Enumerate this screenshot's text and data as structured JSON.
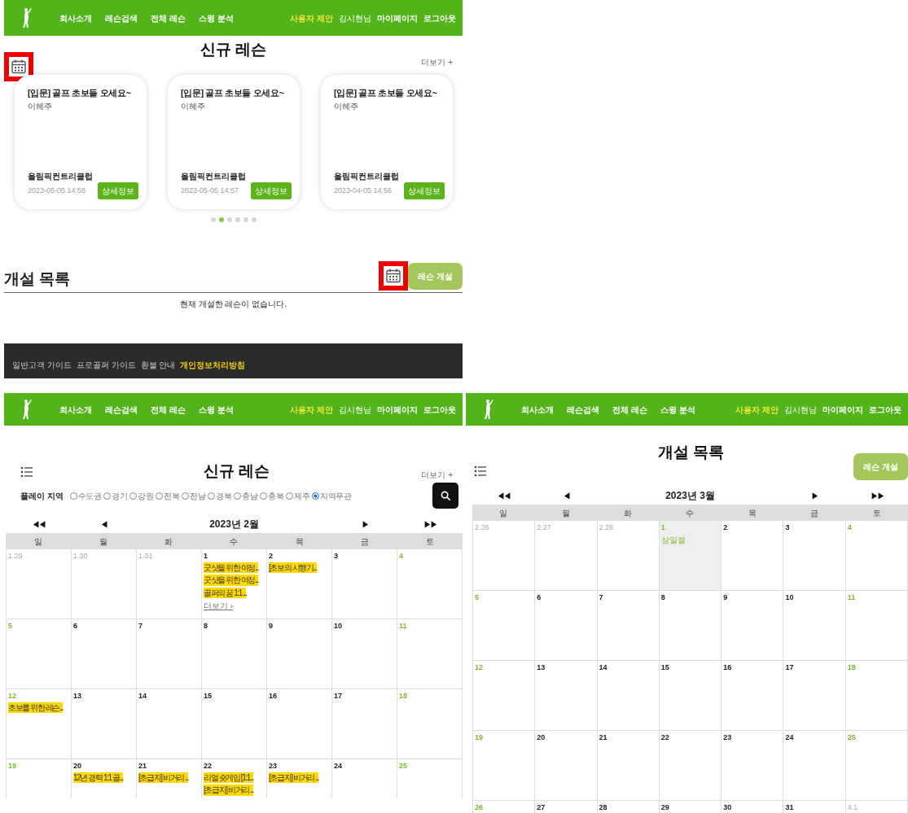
{
  "home_view": {
    "nav": {
      "menu": [
        "회사소개",
        "레슨검색",
        "전체 레슨",
        "스윙 분석"
      ],
      "user_menu": [
        {
          "label": "사용자 제안",
          "kind": "highlight"
        },
        {
          "label": "김시현님",
          "kind": "greeting"
        },
        {
          "label": "마이페이지",
          "kind": "link"
        },
        {
          "label": "로그아웃",
          "kind": "link"
        }
      ]
    },
    "title": "신규 레슨",
    "more": "더보기 +",
    "cards": [
      {
        "title": "[입문] 골프 초보들 오세요~",
        "instructor": "이혜주",
        "club": "올림픽컨트리클럽",
        "datetime": "2023-05-05 14:58",
        "button": "상세정보"
      },
      {
        "title": "[입문] 골프 초보들 오세요~",
        "instructor": "이혜주",
        "club": "올림픽컨트리클럽",
        "datetime": "2023-05-05 14:57",
        "button": "상세정보"
      },
      {
        "title": "[입문] 골프 초보들 오세요~",
        "instructor": "이혜주",
        "club": "올림픽컨트리클럽",
        "datetime": "2023-04-05 14:56",
        "button": "상세정보"
      }
    ],
    "pager": [
      {
        "selected": false
      },
      {
        "selected": true
      },
      {
        "selected": false
      },
      {
        "selected": false
      },
      {
        "selected": false
      },
      {
        "selected": false
      }
    ],
    "section_title": "개설 목록",
    "create_button": "레슨 개설",
    "empty_message": "현재 개설한 레슨이 없습니다.",
    "footer_links": [
      {
        "label": "일반고객 가이드",
        "highlighted": false
      },
      {
        "label": "프로골퍼 가이드",
        "highlighted": false
      },
      {
        "label": "환불 안내",
        "highlighted": false
      },
      {
        "label": "개인정보처리방침",
        "highlighted": true
      }
    ]
  },
  "lesson_calendar_view": {
    "nav": {
      "menu": [
        "회사소개",
        "레슨검색",
        "전체 레슨",
        "스윙 분석"
      ],
      "user_menu": [
        {
          "label": "사용자 제안",
          "kind": "highlight"
        },
        {
          "label": "김시현님",
          "kind": "greeting"
        },
        {
          "label": "마이페이지",
          "kind": "link"
        },
        {
          "label": "로그아웃",
          "kind": "link"
        }
      ]
    },
    "title": "신규 레슨",
    "more": "더보기 +",
    "region": {
      "label": "플레이 지역",
      "options": [
        {
          "label": "수도권",
          "selected": false
        },
        {
          "label": "경기",
          "selected": false
        },
        {
          "label": "강원",
          "selected": false
        },
        {
          "label": "전북",
          "selected": false
        },
        {
          "label": "전남",
          "selected": false
        },
        {
          "label": "경북",
          "selected": false
        },
        {
          "label": "충남",
          "selected": false
        },
        {
          "label": "충북",
          "selected": false
        },
        {
          "label": "제주",
          "selected": false
        },
        {
          "label": "지역무관",
          "selected": true
        }
      ]
    },
    "calendar": {
      "prev_year": "◀◀",
      "prev": "◀",
      "month": "2023년 2월",
      "next": "▶",
      "next_year": "▶▶",
      "weekdays": [
        "일",
        "월",
        "화",
        "수",
        "목",
        "금",
        "토"
      ],
      "weeks": [
        [
          {
            "date": "1.29",
            "kind": "other",
            "today": false
          },
          {
            "date": "1.30",
            "kind": "other",
            "today": false
          },
          {
            "date": "1.31",
            "kind": "other",
            "today": false
          },
          {
            "date": "1",
            "kind": "weekday",
            "today": false,
            "events": [
              "굿샷을 위한 여정...",
              "굿샷을 위한 여정...",
              "골퍼의 꿈 1:1 ..."
            ],
            "more": "더보기 ›"
          },
          {
            "date": "2",
            "kind": "weekday",
            "today": false,
            "events": [
              "[초보의 시행기..."
            ]
          },
          {
            "date": "3",
            "kind": "weekday",
            "today": false
          },
          {
            "date": "4",
            "kind": "weekend",
            "today": false
          }
        ],
        [
          {
            "date": "5",
            "kind": "weekend",
            "today": false
          },
          {
            "date": "6",
            "kind": "weekday",
            "today": false
          },
          {
            "date": "7",
            "kind": "weekday",
            "today": false
          },
          {
            "date": "8",
            "kind": "weekday",
            "today": false
          },
          {
            "date": "9",
            "kind": "weekday",
            "today": false
          },
          {
            "date": "10",
            "kind": "weekday",
            "today": false
          },
          {
            "date": "11",
            "kind": "weekend",
            "today": false
          }
        ],
        [
          {
            "date": "12",
            "kind": "weekend",
            "today": false,
            "events": [
              "초보를 위한 레슨..."
            ]
          },
          {
            "date": "13",
            "kind": "weekday",
            "today": false
          },
          {
            "date": "14",
            "kind": "weekday",
            "today": false
          },
          {
            "date": "15",
            "kind": "weekday",
            "today": false
          },
          {
            "date": "16",
            "kind": "weekday",
            "today": false
          },
          {
            "date": "17",
            "kind": "weekday",
            "today": false
          },
          {
            "date": "18",
            "kind": "weekend",
            "today": false
          }
        ],
        [
          {
            "date": "19",
            "kind": "weekend",
            "today": false
          },
          {
            "date": "20",
            "kind": "weekday",
            "today": false,
            "events": [
              "12년 경력 1:1 골..."
            ]
          },
          {
            "date": "21",
            "kind": "weekday",
            "today": false,
            "events": [
              "[초급자] 비거리 ..."
            ]
          },
          {
            "date": "22",
            "kind": "weekday",
            "today": false,
            "events": [
              "리얼 숏게임 [1:1...",
              "[초급자] 비거리 ..."
            ]
          },
          {
            "date": "23",
            "kind": "weekday",
            "today": false,
            "events": [
              "[초급자] 비거리 ..."
            ]
          },
          {
            "date": "24",
            "kind": "weekday",
            "today": false
          },
          {
            "date": "25",
            "kind": "weekend",
            "today": false
          }
        ]
      ]
    }
  },
  "opened_calendar_view": {
    "nav": {
      "menu": [
        "회사소개",
        "레슨검색",
        "전체 레슨",
        "스윙 분석"
      ],
      "user_menu": [
        {
          "label": "사용자 제안",
          "kind": "highlight"
        },
        {
          "label": "김시현님",
          "kind": "greeting"
        },
        {
          "label": "마이페이지",
          "kind": "link"
        },
        {
          "label": "로그아웃",
          "kind": "link"
        }
      ]
    },
    "title": "개설 목록",
    "create_button": "레슨 개설",
    "calendar": {
      "prev_year": "◀◀",
      "prev": "◀",
      "month": "2023년 3월",
      "next": "▶",
      "next_year": "▶▶",
      "weekdays": [
        "일",
        "월",
        "화",
        "수",
        "목",
        "금",
        "토"
      ],
      "weeks": [
        [
          {
            "date": "2.26",
            "kind": "other",
            "today": false
          },
          {
            "date": "2.27",
            "kind": "other",
            "today": false
          },
          {
            "date": "2.28",
            "kind": "other",
            "today": false
          },
          {
            "date": "1",
            "kind": "holiday",
            "today": true,
            "holiday_name": "삼일절"
          },
          {
            "date": "2",
            "kind": "weekday",
            "today": false
          },
          {
            "date": "3",
            "kind": "weekday",
            "today": false
          },
          {
            "date": "4",
            "kind": "weekend",
            "today": false
          }
        ],
        [
          {
            "date": "5",
            "kind": "weekend",
            "today": false
          },
          {
            "date": "6",
            "kind": "weekday",
            "today": false
          },
          {
            "date": "7",
            "kind": "weekday",
            "today": false
          },
          {
            "date": "8",
            "kind": "weekday",
            "today": false
          },
          {
            "date": "9",
            "kind": "weekday",
            "today": false
          },
          {
            "date": "10",
            "kind": "weekday",
            "today": false
          },
          {
            "date": "11",
            "kind": "weekend",
            "today": false
          }
        ],
        [
          {
            "date": "12",
            "kind": "weekend",
            "today": false
          },
          {
            "date": "13",
            "kind": "weekday",
            "today": false
          },
          {
            "date": "14",
            "kind": "weekday",
            "today": false
          },
          {
            "date": "15",
            "kind": "weekday",
            "today": false
          },
          {
            "date": "16",
            "kind": "weekday",
            "today": false
          },
          {
            "date": "17",
            "kind": "weekday",
            "today": false
          },
          {
            "date": "18",
            "kind": "weekend",
            "today": false
          }
        ],
        [
          {
            "date": "19",
            "kind": "weekend",
            "today": false
          },
          {
            "date": "20",
            "kind": "weekday",
            "today": false
          },
          {
            "date": "21",
            "kind": "weekday",
            "today": false
          },
          {
            "date": "22",
            "kind": "weekday",
            "today": false
          },
          {
            "date": "23",
            "kind": "weekday",
            "today": false
          },
          {
            "date": "24",
            "kind": "weekday",
            "today": false
          },
          {
            "date": "25",
            "kind": "weekend",
            "today": false
          }
        ],
        [
          {
            "date": "26",
            "kind": "weekend",
            "today": false
          },
          {
            "date": "27",
            "kind": "weekday",
            "today": false
          },
          {
            "date": "28",
            "kind": "weekday",
            "today": false
          },
          {
            "date": "29",
            "kind": "weekday",
            "today": false
          },
          {
            "date": "30",
            "kind": "weekday",
            "today": false
          },
          {
            "date": "31",
            "kind": "weekday",
            "today": false
          },
          {
            "date": "4.1",
            "kind": "other",
            "today": false
          }
        ]
      ]
    }
  }
}
